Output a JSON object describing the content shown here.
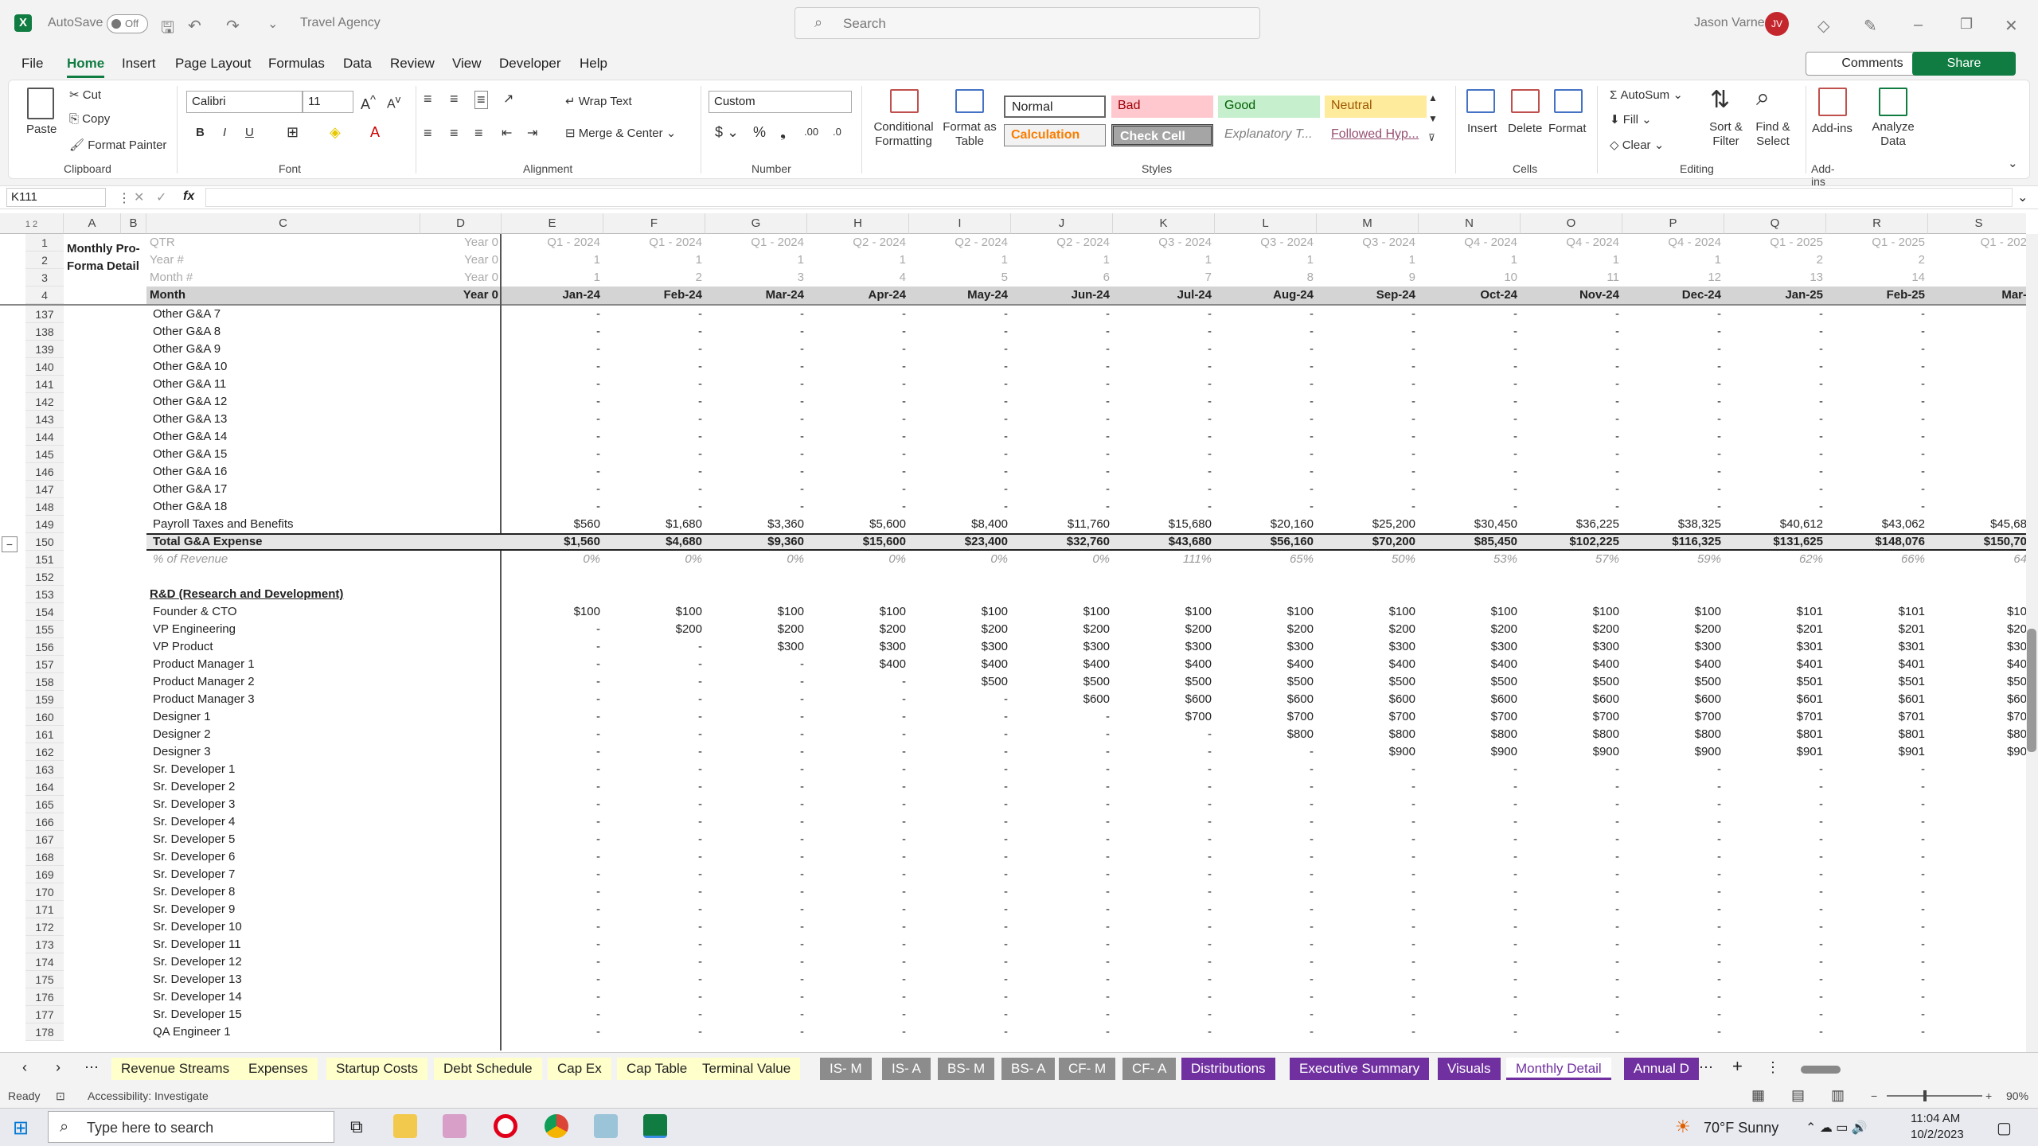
{
  "titlebar": {
    "autosave": "AutoSave",
    "autosave_state": "Off",
    "doc_name": "Travel Agency",
    "search": "Search",
    "user": "Jason Varner",
    "initials": "JV"
  },
  "menu": [
    "File",
    "Home",
    "Insert",
    "Page Layout",
    "Formulas",
    "Data",
    "Review",
    "View",
    "Developer",
    "Help"
  ],
  "menu_active": "Home",
  "comments": "Comments",
  "share": "Share",
  "ribbon": {
    "paste": "Paste",
    "cut": "Cut",
    "copy": "Copy",
    "format_painter": "Format Painter",
    "clipboard": "Clipboard",
    "font_name": "Calibri",
    "font_size": "11",
    "font": "Font",
    "wrap_text": "Wrap Text",
    "merge_center": "Merge & Center",
    "alignment": "Alignment",
    "number_format": "Custom",
    "number": "Number",
    "cond_fmt": "Conditional Formatting",
    "fmt_table": "Format as Table",
    "styles": [
      "Normal",
      "Bad",
      "Good",
      "Neutral",
      "Calculation",
      "Check Cell",
      "Explanatory T...",
      "Followed Hyp..."
    ],
    "styles_label": "Styles",
    "insert": "Insert",
    "delete": "Delete",
    "format": "Format",
    "cells": "Cells",
    "autosum": "AutoSum",
    "fill": "Fill",
    "clear": "Clear",
    "sort_filter": "Sort & Filter",
    "find_select": "Find & Select",
    "editing": "Editing",
    "addins": "Add-ins",
    "analyze": "Analyze Data",
    "addins_label": "Add-ins"
  },
  "namebox": "K111",
  "fx": "fx",
  "columns": [
    "A",
    "B",
    "C",
    "D",
    "E",
    "F",
    "G",
    "H",
    "I",
    "J",
    "K",
    "L",
    "M",
    "N",
    "O",
    "P",
    "Q",
    "R",
    "S"
  ],
  "header_block": {
    "title1": "Monthly Pro-",
    "title2": "Forma Detail",
    "labels": [
      "QTR",
      "Year #",
      "Month #",
      "Month"
    ],
    "year0": [
      "Year 0",
      "Year 0",
      "Year 0",
      "Year 0"
    ],
    "qtr": [
      "Q1 - 2024",
      "Q1 - 2024",
      "Q1 - 2024",
      "Q2 - 2024",
      "Q2 - 2024",
      "Q2 - 2024",
      "Q3 - 2024",
      "Q3 - 2024",
      "Q3 - 2024",
      "Q4 - 2024",
      "Q4 - 2024",
      "Q4 - 2024",
      "Q1 - 2025",
      "Q1 - 2025",
      "Q1 - 202"
    ],
    "year": [
      "1",
      "1",
      "1",
      "1",
      "1",
      "1",
      "1",
      "1",
      "1",
      "1",
      "1",
      "1",
      "2",
      "2",
      ""
    ],
    "month_num": [
      "1",
      "2",
      "3",
      "4",
      "5",
      "6",
      "7",
      "8",
      "9",
      "10",
      "11",
      "12",
      "13",
      "14",
      ""
    ],
    "month": [
      "Jan-24",
      "Feb-24",
      "Mar-24",
      "Apr-24",
      "May-24",
      "Jun-24",
      "Jul-24",
      "Aug-24",
      "Sep-24",
      "Oct-24",
      "Nov-24",
      "Dec-24",
      "Jan-25",
      "Feb-25",
      "Mar-"
    ]
  },
  "rows": [
    {
      "n": "137",
      "label": "Other G&A 7",
      "v": [
        "-",
        "-",
        "-",
        "-",
        "-",
        "-",
        "-",
        "-",
        "-",
        "-",
        "-",
        "-",
        "-",
        "-",
        ""
      ]
    },
    {
      "n": "138",
      "label": "Other G&A 8",
      "v": [
        "-",
        "-",
        "-",
        "-",
        "-",
        "-",
        "-",
        "-",
        "-",
        "-",
        "-",
        "-",
        "-",
        "-",
        ""
      ]
    },
    {
      "n": "139",
      "label": "Other G&A 9",
      "v": [
        "-",
        "-",
        "-",
        "-",
        "-",
        "-",
        "-",
        "-",
        "-",
        "-",
        "-",
        "-",
        "-",
        "-",
        ""
      ]
    },
    {
      "n": "140",
      "label": "Other G&A 10",
      "v": [
        "-",
        "-",
        "-",
        "-",
        "-",
        "-",
        "-",
        "-",
        "-",
        "-",
        "-",
        "-",
        "-",
        "-",
        ""
      ]
    },
    {
      "n": "141",
      "label": "Other G&A 11",
      "v": [
        "-",
        "-",
        "-",
        "-",
        "-",
        "-",
        "-",
        "-",
        "-",
        "-",
        "-",
        "-",
        "-",
        "-",
        ""
      ]
    },
    {
      "n": "142",
      "label": "Other G&A 12",
      "v": [
        "-",
        "-",
        "-",
        "-",
        "-",
        "-",
        "-",
        "-",
        "-",
        "-",
        "-",
        "-",
        "-",
        "-",
        ""
      ]
    },
    {
      "n": "143",
      "label": "Other G&A 13",
      "v": [
        "-",
        "-",
        "-",
        "-",
        "-",
        "-",
        "-",
        "-",
        "-",
        "-",
        "-",
        "-",
        "-",
        "-",
        ""
      ]
    },
    {
      "n": "144",
      "label": "Other G&A 14",
      "v": [
        "-",
        "-",
        "-",
        "-",
        "-",
        "-",
        "-",
        "-",
        "-",
        "-",
        "-",
        "-",
        "-",
        "-",
        ""
      ]
    },
    {
      "n": "145",
      "label": "Other G&A 15",
      "v": [
        "-",
        "-",
        "-",
        "-",
        "-",
        "-",
        "-",
        "-",
        "-",
        "-",
        "-",
        "-",
        "-",
        "-",
        ""
      ]
    },
    {
      "n": "146",
      "label": "Other G&A 16",
      "v": [
        "-",
        "-",
        "-",
        "-",
        "-",
        "-",
        "-",
        "-",
        "-",
        "-",
        "-",
        "-",
        "-",
        "-",
        ""
      ]
    },
    {
      "n": "147",
      "label": "Other G&A 17",
      "v": [
        "-",
        "-",
        "-",
        "-",
        "-",
        "-",
        "-",
        "-",
        "-",
        "-",
        "-",
        "-",
        "-",
        "-",
        ""
      ]
    },
    {
      "n": "148",
      "label": "Other G&A 18",
      "v": [
        "-",
        "-",
        "-",
        "-",
        "-",
        "-",
        "-",
        "-",
        "-",
        "-",
        "-",
        "-",
        "-",
        "-",
        ""
      ]
    },
    {
      "n": "149",
      "label": "Payroll Taxes and Benefits",
      "v": [
        "$560",
        "$1,680",
        "$3,360",
        "$5,600",
        "$8,400",
        "$11,760",
        "$15,680",
        "$20,160",
        "$25,200",
        "$30,450",
        "$36,225",
        "$38,325",
        "$40,612",
        "$43,062",
        "$45,68"
      ]
    },
    {
      "n": "150",
      "label": "Total G&A Expense",
      "style": "total",
      "v": [
        "$1,560",
        "$4,680",
        "$9,360",
        "$15,600",
        "$23,400",
        "$32,760",
        "$43,680",
        "$56,160",
        "$70,200",
        "$85,450",
        "$102,225",
        "$116,325",
        "$131,625",
        "$148,076",
        "$150,70"
      ]
    },
    {
      "n": "151",
      "label": "% of Revenue",
      "style": "pct",
      "v": [
        "0%",
        "0%",
        "0%",
        "0%",
        "0%",
        "0%",
        "111%",
        "65%",
        "50%",
        "53%",
        "57%",
        "59%",
        "62%",
        "66%",
        "64"
      ]
    },
    {
      "n": "152",
      "label": "",
      "v": []
    },
    {
      "n": "153",
      "label": "R&D (Research and Development)",
      "style": "section",
      "v": []
    },
    {
      "n": "154",
      "label": "Founder & CTO",
      "v": [
        "$100",
        "$100",
        "$100",
        "$100",
        "$100",
        "$100",
        "$100",
        "$100",
        "$100",
        "$100",
        "$100",
        "$100",
        "$101",
        "$101",
        "$10"
      ]
    },
    {
      "n": "155",
      "label": "VP Engineering",
      "v": [
        "-",
        "$200",
        "$200",
        "$200",
        "$200",
        "$200",
        "$200",
        "$200",
        "$200",
        "$200",
        "$200",
        "$200",
        "$201",
        "$201",
        "$20"
      ]
    },
    {
      "n": "156",
      "label": "VP Product",
      "v": [
        "-",
        "-",
        "$300",
        "$300",
        "$300",
        "$300",
        "$300",
        "$300",
        "$300",
        "$300",
        "$300",
        "$300",
        "$301",
        "$301",
        "$30"
      ]
    },
    {
      "n": "157",
      "label": "Product Manager 1",
      "v": [
        "-",
        "-",
        "-",
        "$400",
        "$400",
        "$400",
        "$400",
        "$400",
        "$400",
        "$400",
        "$400",
        "$400",
        "$401",
        "$401",
        "$40"
      ]
    },
    {
      "n": "158",
      "label": "Product Manager 2",
      "v": [
        "-",
        "-",
        "-",
        "-",
        "$500",
        "$500",
        "$500",
        "$500",
        "$500",
        "$500",
        "$500",
        "$500",
        "$501",
        "$501",
        "$50"
      ]
    },
    {
      "n": "159",
      "label": "Product Manager 3",
      "v": [
        "-",
        "-",
        "-",
        "-",
        "-",
        "$600",
        "$600",
        "$600",
        "$600",
        "$600",
        "$600",
        "$600",
        "$601",
        "$601",
        "$60"
      ]
    },
    {
      "n": "160",
      "label": "Designer 1",
      "v": [
        "-",
        "-",
        "-",
        "-",
        "-",
        "-",
        "$700",
        "$700",
        "$700",
        "$700",
        "$700",
        "$700",
        "$701",
        "$701",
        "$70"
      ]
    },
    {
      "n": "161",
      "label": "Designer 2",
      "v": [
        "-",
        "-",
        "-",
        "-",
        "-",
        "-",
        "-",
        "$800",
        "$800",
        "$800",
        "$800",
        "$800",
        "$801",
        "$801",
        "$80"
      ]
    },
    {
      "n": "162",
      "label": "Designer 3",
      "v": [
        "-",
        "-",
        "-",
        "-",
        "-",
        "-",
        "-",
        "-",
        "$900",
        "$900",
        "$900",
        "$900",
        "$901",
        "$901",
        "$90"
      ]
    },
    {
      "n": "163",
      "label": "Sr. Developer 1",
      "v": [
        "-",
        "-",
        "-",
        "-",
        "-",
        "-",
        "-",
        "-",
        "-",
        "-",
        "-",
        "-",
        "-",
        "-",
        ""
      ]
    },
    {
      "n": "164",
      "label": "Sr. Developer 2",
      "v": [
        "-",
        "-",
        "-",
        "-",
        "-",
        "-",
        "-",
        "-",
        "-",
        "-",
        "-",
        "-",
        "-",
        "-",
        ""
      ]
    },
    {
      "n": "165",
      "label": "Sr. Developer 3",
      "v": [
        "-",
        "-",
        "-",
        "-",
        "-",
        "-",
        "-",
        "-",
        "-",
        "-",
        "-",
        "-",
        "-",
        "-",
        ""
      ]
    },
    {
      "n": "166",
      "label": "Sr. Developer 4",
      "v": [
        "-",
        "-",
        "-",
        "-",
        "-",
        "-",
        "-",
        "-",
        "-",
        "-",
        "-",
        "-",
        "-",
        "-",
        ""
      ]
    },
    {
      "n": "167",
      "label": "Sr. Developer 5",
      "v": [
        "-",
        "-",
        "-",
        "-",
        "-",
        "-",
        "-",
        "-",
        "-",
        "-",
        "-",
        "-",
        "-",
        "-",
        ""
      ]
    },
    {
      "n": "168",
      "label": "Sr. Developer 6",
      "v": [
        "-",
        "-",
        "-",
        "-",
        "-",
        "-",
        "-",
        "-",
        "-",
        "-",
        "-",
        "-",
        "-",
        "-",
        ""
      ]
    },
    {
      "n": "169",
      "label": "Sr. Developer 7",
      "v": [
        "-",
        "-",
        "-",
        "-",
        "-",
        "-",
        "-",
        "-",
        "-",
        "-",
        "-",
        "-",
        "-",
        "-",
        ""
      ]
    },
    {
      "n": "170",
      "label": "Sr. Developer 8",
      "v": [
        "-",
        "-",
        "-",
        "-",
        "-",
        "-",
        "-",
        "-",
        "-",
        "-",
        "-",
        "-",
        "-",
        "-",
        ""
      ]
    },
    {
      "n": "171",
      "label": "Sr. Developer 9",
      "v": [
        "-",
        "-",
        "-",
        "-",
        "-",
        "-",
        "-",
        "-",
        "-",
        "-",
        "-",
        "-",
        "-",
        "-",
        ""
      ]
    },
    {
      "n": "172",
      "label": "Sr. Developer 10",
      "v": [
        "-",
        "-",
        "-",
        "-",
        "-",
        "-",
        "-",
        "-",
        "-",
        "-",
        "-",
        "-",
        "-",
        "-",
        ""
      ]
    },
    {
      "n": "173",
      "label": "Sr. Developer 11",
      "v": [
        "-",
        "-",
        "-",
        "-",
        "-",
        "-",
        "-",
        "-",
        "-",
        "-",
        "-",
        "-",
        "-",
        "-",
        ""
      ]
    },
    {
      "n": "174",
      "label": "Sr. Developer 12",
      "v": [
        "-",
        "-",
        "-",
        "-",
        "-",
        "-",
        "-",
        "-",
        "-",
        "-",
        "-",
        "-",
        "-",
        "-",
        ""
      ]
    },
    {
      "n": "175",
      "label": "Sr. Developer 13",
      "v": [
        "-",
        "-",
        "-",
        "-",
        "-",
        "-",
        "-",
        "-",
        "-",
        "-",
        "-",
        "-",
        "-",
        "-",
        ""
      ]
    },
    {
      "n": "176",
      "label": "Sr. Developer 14",
      "v": [
        "-",
        "-",
        "-",
        "-",
        "-",
        "-",
        "-",
        "-",
        "-",
        "-",
        "-",
        "-",
        "-",
        "-",
        ""
      ]
    },
    {
      "n": "177",
      "label": "Sr. Developer 15",
      "v": [
        "-",
        "-",
        "-",
        "-",
        "-",
        "-",
        "-",
        "-",
        "-",
        "-",
        "-",
        "-",
        "-",
        "-",
        ""
      ]
    },
    {
      "n": "178",
      "label": "QA Engineer 1",
      "v": [
        "-",
        "-",
        "-",
        "-",
        "-",
        "-",
        "-",
        "-",
        "-",
        "-",
        "-",
        "-",
        "-",
        "-",
        ""
      ]
    }
  ],
  "tabs": [
    {
      "label": "Revenue Streams",
      "c": "y"
    },
    {
      "label": "Expenses",
      "c": "y"
    },
    {
      "label": "Startup Costs",
      "c": "y"
    },
    {
      "label": "Debt Schedule",
      "c": "y"
    },
    {
      "label": "Cap Ex",
      "c": "y"
    },
    {
      "label": "Cap Table",
      "c": "y"
    },
    {
      "label": "Terminal Value",
      "c": "y"
    },
    {
      "label": "IS- M",
      "c": "g"
    },
    {
      "label": "IS- A",
      "c": "g"
    },
    {
      "label": "BS- M",
      "c": "g"
    },
    {
      "label": "BS- A",
      "c": "g"
    },
    {
      "label": "CF- M",
      "c": "g"
    },
    {
      "label": "CF- A",
      "c": "g"
    },
    {
      "label": "Distributions",
      "c": "p"
    },
    {
      "label": "Executive Summary",
      "c": "p"
    },
    {
      "label": "Visuals",
      "c": "p"
    },
    {
      "label": "Monthly Detail",
      "c": "active"
    },
    {
      "label": "Annual D",
      "c": "p"
    }
  ],
  "status": {
    "ready": "Ready",
    "accessibility": "Accessibility: Investigate",
    "zoom": "90%"
  },
  "taskbar": {
    "search": "Type here to search",
    "weather": "70°F  Sunny",
    "time": "11:04 AM",
    "date": "10/2/2023"
  }
}
